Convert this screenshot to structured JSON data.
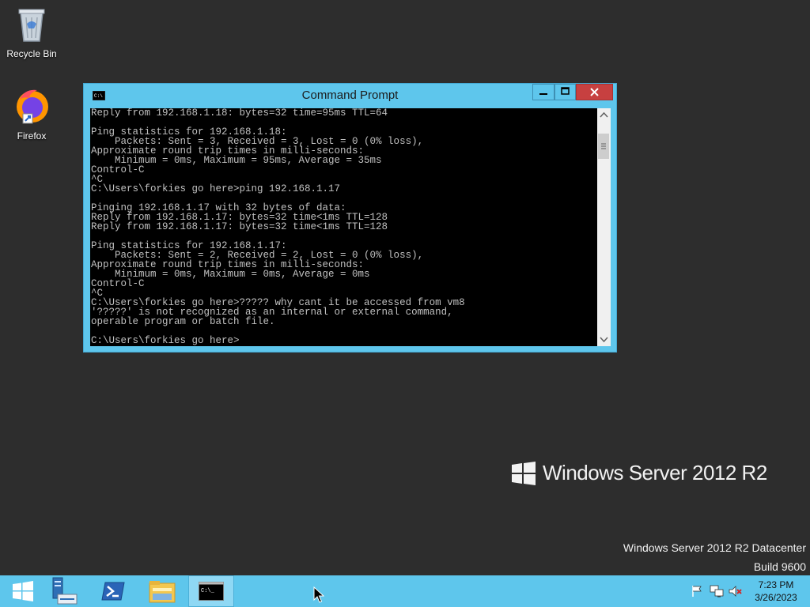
{
  "desktop": {
    "icons": [
      {
        "label": "Recycle Bin",
        "icon": "recycle-bin-icon"
      },
      {
        "label": "Firefox",
        "icon": "firefox-icon"
      }
    ],
    "watermark": {
      "brand": "Windows Server 2012 R2",
      "edition": "Windows Server 2012 R2 Datacenter",
      "build": "Build 9600"
    }
  },
  "window": {
    "title": "Command Prompt",
    "console_text": "Reply from 192.168.1.18: bytes=32 time=95ms TTL=64\n\nPing statistics for 192.168.1.18:\n    Packets: Sent = 3, Received = 3, Lost = 0 (0% loss),\nApproximate round trip times in milli-seconds:\n    Minimum = 0ms, Maximum = 95ms, Average = 35ms\nControl-C\n^C\nC:\\Users\\forkies go here>ping 192.168.1.17\n\nPinging 192.168.1.17 with 32 bytes of data:\nReply from 192.168.1.17: bytes=32 time<1ms TTL=128\nReply from 192.168.1.17: bytes=32 time<1ms TTL=128\n\nPing statistics for 192.168.1.17:\n    Packets: Sent = 2, Received = 2, Lost = 0 (0% loss),\nApproximate round trip times in milli-seconds:\n    Minimum = 0ms, Maximum = 0ms, Average = 0ms\nControl-C\n^C\nC:\\Users\\forkies go here>????? why cant it be accessed from vm8\n'?????' is not recognized as an internal or external command,\noperable program or batch file.\n\nC:\\Users\\forkies go here>"
  },
  "taskbar": {
    "buttons": [
      "start-button",
      "server-manager",
      "powershell",
      "file-explorer",
      "command-prompt"
    ],
    "tray": [
      "action-center-flag-icon",
      "network-icon",
      "volume-muted-icon"
    ],
    "clock": {
      "time": "7:23 PM",
      "date": "3/26/2023"
    }
  },
  "colors": {
    "accent": "#5ec6ec",
    "desktop_bg": "#2d2d2d",
    "close_button": "#c74040",
    "console_bg": "#000000",
    "console_fg": "#c0c0c0"
  }
}
